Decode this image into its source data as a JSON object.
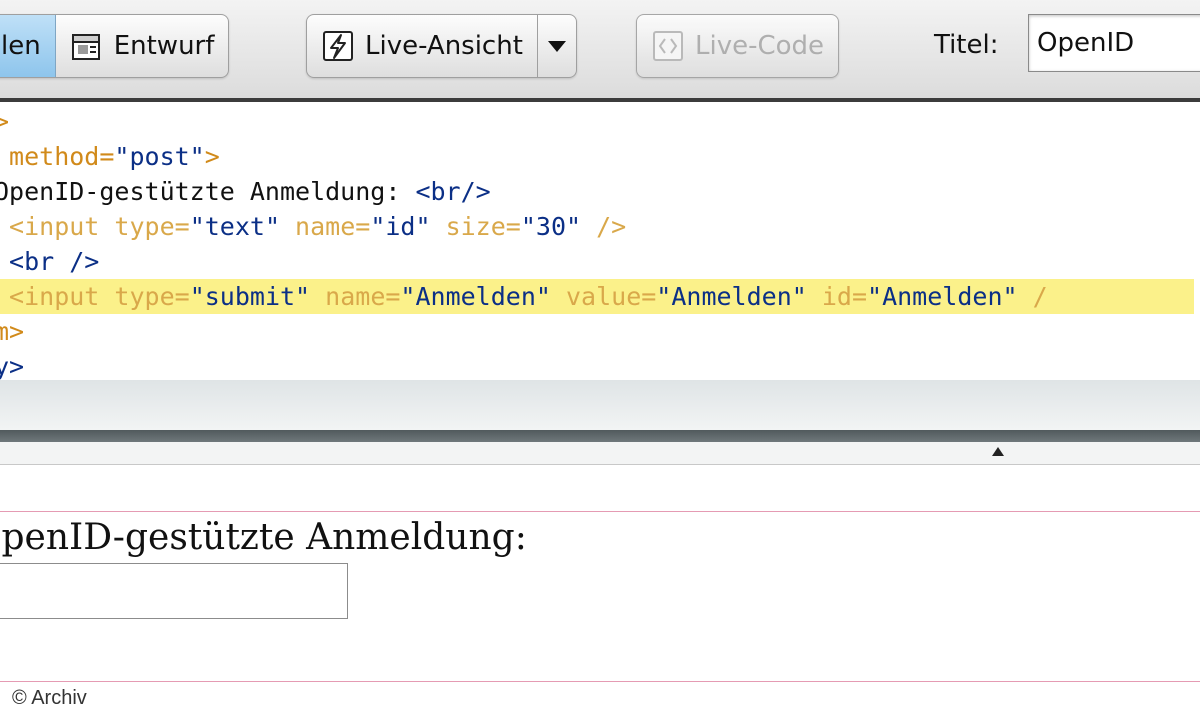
{
  "toolbar": {
    "view_buttons": {
      "split_label": "len",
      "design_label": "Entwurf"
    },
    "live_view_label": "Live-Ansicht",
    "live_code_label": "Live-Code",
    "title_label": "Titel:",
    "title_value": "OpenID"
  },
  "code": {
    "lines": [
      {
        "parts": [
          {
            "t": ">",
            "c": "attr"
          }
        ]
      },
      {
        "parts": [
          {
            "t": " method=",
            "c": "attr"
          },
          {
            "t": "\"post\"",
            "c": "val"
          },
          {
            "t": ">",
            "c": "attr"
          }
        ]
      },
      {
        "parts": [
          {
            "t": "OpenID-gestützte Anmeldung: ",
            "c": "text"
          },
          {
            "t": "<br/>",
            "c": "tag"
          }
        ]
      },
      {
        "parts": [
          {
            "t": " <input ",
            "c": "dim"
          },
          {
            "t": "type=",
            "c": "dim"
          },
          {
            "t": "\"text\"",
            "c": "val"
          },
          {
            "t": " name=",
            "c": "dim"
          },
          {
            "t": "\"id\"",
            "c": "val"
          },
          {
            "t": " size=",
            "c": "dim"
          },
          {
            "t": "\"30\"",
            "c": "val"
          },
          {
            "t": " />",
            "c": "dim"
          }
        ]
      },
      {
        "parts": [
          {
            "t": " <br />",
            "c": "tag"
          }
        ]
      },
      {
        "parts": [
          {
            "t": " <input ",
            "c": "dim"
          },
          {
            "t": "type=",
            "c": "dim"
          },
          {
            "t": "\"submit\"",
            "c": "val"
          },
          {
            "t": " name=",
            "c": "dim"
          },
          {
            "t": "\"Anmelden\"",
            "c": "val"
          },
          {
            "t": " value=",
            "c": "dim"
          },
          {
            "t": "\"Anmelden\"",
            "c": "val"
          },
          {
            "t": " id=",
            "c": "dim"
          },
          {
            "t": "\"Anmelden\"",
            "c": "val"
          },
          {
            "t": " /",
            "c": "dim"
          }
        ]
      },
      {
        "parts": [
          {
            "t": "m>",
            "c": "attr"
          }
        ]
      },
      {
        "parts": [
          {
            "t": "y>",
            "c": "tag"
          }
        ]
      }
    ],
    "highlight_line": 5
  },
  "design": {
    "label_text": "OpenID-gestützte Anmeldung:"
  },
  "copyright": "© Archiv",
  "colors": {
    "highlight": "#fbf18a",
    "tag": "#0b2f86",
    "attr": "#d18a1a",
    "active_button": "#8ec5ec",
    "guide_line": "#e59bb3"
  },
  "icons": {
    "split": "split-view-icon",
    "design": "design-view-icon",
    "live_view": "live-view-bolt-icon",
    "dropdown": "dropdown-arrow-icon",
    "live_code": "live-code-icon"
  }
}
